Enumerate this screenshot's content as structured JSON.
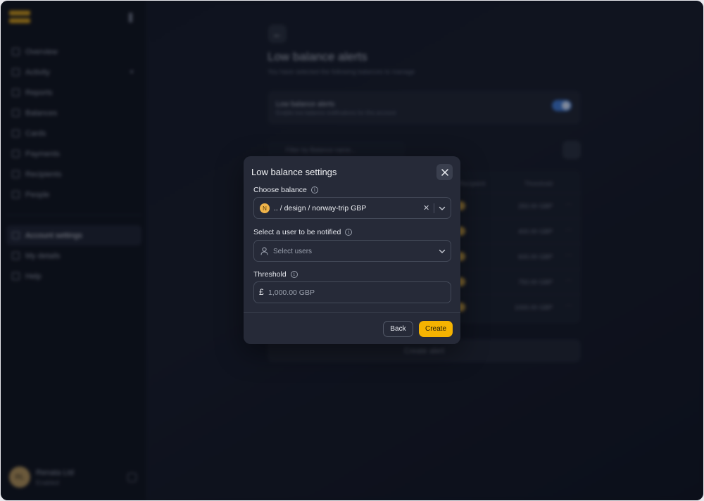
{
  "sidebar": {
    "items": [
      {
        "label": "Overview"
      },
      {
        "label": "Activity"
      },
      {
        "label": "Reports"
      },
      {
        "label": "Balances"
      },
      {
        "label": "Cards"
      },
      {
        "label": "Payments"
      },
      {
        "label": "Recipients"
      },
      {
        "label": "People"
      }
    ],
    "settings_items": [
      {
        "label": "Account settings"
      },
      {
        "label": "My details"
      },
      {
        "label": "Help"
      }
    ],
    "account": {
      "initials": "RL",
      "name": "Renata Ltd",
      "plan": "Enabled"
    }
  },
  "page": {
    "title": "Low balance alerts",
    "subtitle": "You have selected the following balances to manage",
    "toggle_title": "Low balance alerts",
    "toggle_desc": "Enable low balance notifications for this account",
    "toggle_on": true,
    "filter_placeholder": "Filter by Balance name...",
    "columns": {
      "recipient": "Recipient",
      "threshold": "Threshold"
    },
    "rows": [
      {
        "threshold": "250.00 GBP"
      },
      {
        "threshold": "400.00 GBP"
      },
      {
        "threshold": "600.00 GBP"
      },
      {
        "threshold": "750.00 GBP"
      },
      {
        "threshold": "1000.00 GBP"
      }
    ],
    "create_alert_label": "Create alert"
  },
  "modal": {
    "title": "Low balance settings",
    "balance_label": "Choose balance",
    "balance_badge": "N",
    "balance_value": ".. / design / norway-trip GBP",
    "user_label": "Select a user to be notified",
    "user_placeholder": "Select users",
    "threshold_label": "Threshold",
    "currency_symbol": "£",
    "threshold_placeholder": "1,000.00 GBP",
    "back_label": "Back",
    "create_label": "Create"
  },
  "colors": {
    "accent": "#f5b301",
    "modal_bg": "#262a38",
    "page_bg": "#101420",
    "badge": "#f0b44a"
  }
}
